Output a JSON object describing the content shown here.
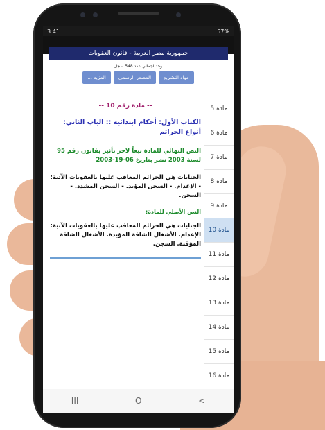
{
  "status": {
    "time": "3:41",
    "right": "57%"
  },
  "title": "جمهورية مصر العربية - قانون العقوبات",
  "count_text": "وجد اجمالي عدد 548 سجل",
  "buttons": [
    {
      "label": "مواد التشريع"
    },
    {
      "label": "المصدر الرسمي"
    },
    {
      "label": "المزيد ..."
    }
  ],
  "sidebar": [
    {
      "label": "مادة 5"
    },
    {
      "label": "مادة 6"
    },
    {
      "label": "مادة 7"
    },
    {
      "label": "مادة 8"
    },
    {
      "label": "مادة 9"
    },
    {
      "label": "مادة 10"
    },
    {
      "label": "مادة 11"
    },
    {
      "label": "مادة 12"
    },
    {
      "label": "مادة 13"
    },
    {
      "label": "مادة 14"
    },
    {
      "label": "مادة 15"
    },
    {
      "label": "مادة 16"
    }
  ],
  "article": {
    "heading": "-- مادة رقم 10 --",
    "chapter": "الكتاب الأول: أحكام ابتدائية :: الباب الثاني: أنواع الجرائم",
    "final_label": "النص النهائي للمادة تبعاً لاخر تأثير بقانون رقم 95 لسنة 2003 نشر بتاريخ 06-19-2003",
    "text_final": "الجنايات هي الجرائم المعاقب عليها بالعقوبات الآتية: - الإعدام. - السجن المؤبد. - السجن المشدد. - السجن.",
    "orig_label": "النص الأصلي للمادة:",
    "text_orig": "الجنايات هي الجرائم المعاقب عليها بالعقوبات الآتية: الإعدام. الأشغال الشاقة المؤبدة. الأشغال الشاقة المؤقتة. السجن."
  },
  "nav": {
    "recent": "III",
    "home": "O",
    "back": "<"
  }
}
